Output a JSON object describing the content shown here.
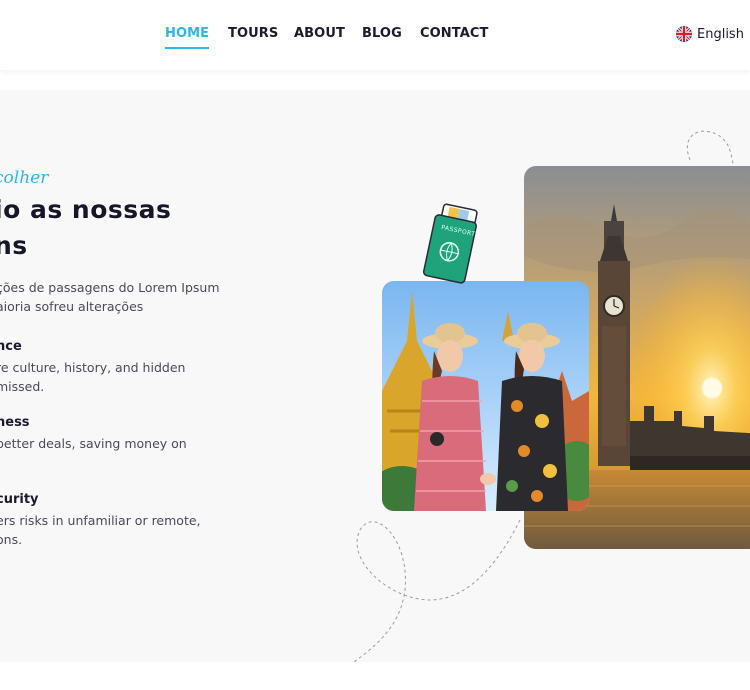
{
  "nav": {
    "items": [
      {
        "label": "HOME",
        "active": true
      },
      {
        "label": "TOURS",
        "active": false
      },
      {
        "label": "ABOUT",
        "active": false
      },
      {
        "label": "BLOG",
        "active": false
      },
      {
        "label": "CONTACT",
        "active": false
      }
    ],
    "language": {
      "label": "English",
      "icon": "uk-flag-icon"
    }
  },
  "hero": {
    "eyebrow": "colher",
    "title_line1": "io as nossas",
    "title_line2": "ns",
    "description_line1": "ções de passagens do Lorem Ipsum",
    "description_line2": "aioria sofreu alterações",
    "features": [
      {
        "title": "nce",
        "line1": "re culture, history, and hidden",
        "line2": " missed."
      },
      {
        "title": "ness",
        "line1": "better deals, saving money on",
        "line2": ""
      },
      {
        "title": "curity",
        "line1": "ers risks in unfamiliar or remote,",
        "line2": "ons."
      }
    ],
    "passport_label": "PASSPORT"
  },
  "colors": {
    "accent": "#2bb6e6",
    "text_dark": "#1b1b2f",
    "hero_background": "#f8f8f9",
    "passport_green": "#1fa37a"
  }
}
